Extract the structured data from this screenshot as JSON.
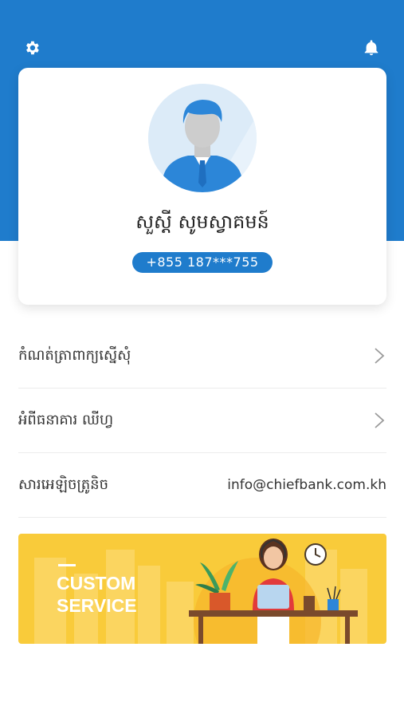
{
  "header": {
    "settings_icon": "gear-icon",
    "bell_icon": "bell-icon",
    "background_color": "#1f7ccc"
  },
  "profile": {
    "greeting": "សួស្តី សូមស្វាគមន៍",
    "phone": "+855 187***755"
  },
  "menu": {
    "items": [
      {
        "label": "កំណត់ត្រាពាក្យស្នើសុំ",
        "icon": "chevron-right-icon"
      },
      {
        "label": "អំពីធនាគារ ឈីហ្វ",
        "icon": "chevron-right-icon"
      },
      {
        "label": "សារអេឡិចត្រូនិច",
        "value": "info@chiefbank.com.kh"
      }
    ]
  },
  "banner": {
    "line1": "CUSTOM",
    "line2": "SERVICE",
    "background_color": "#f9cb3a"
  }
}
